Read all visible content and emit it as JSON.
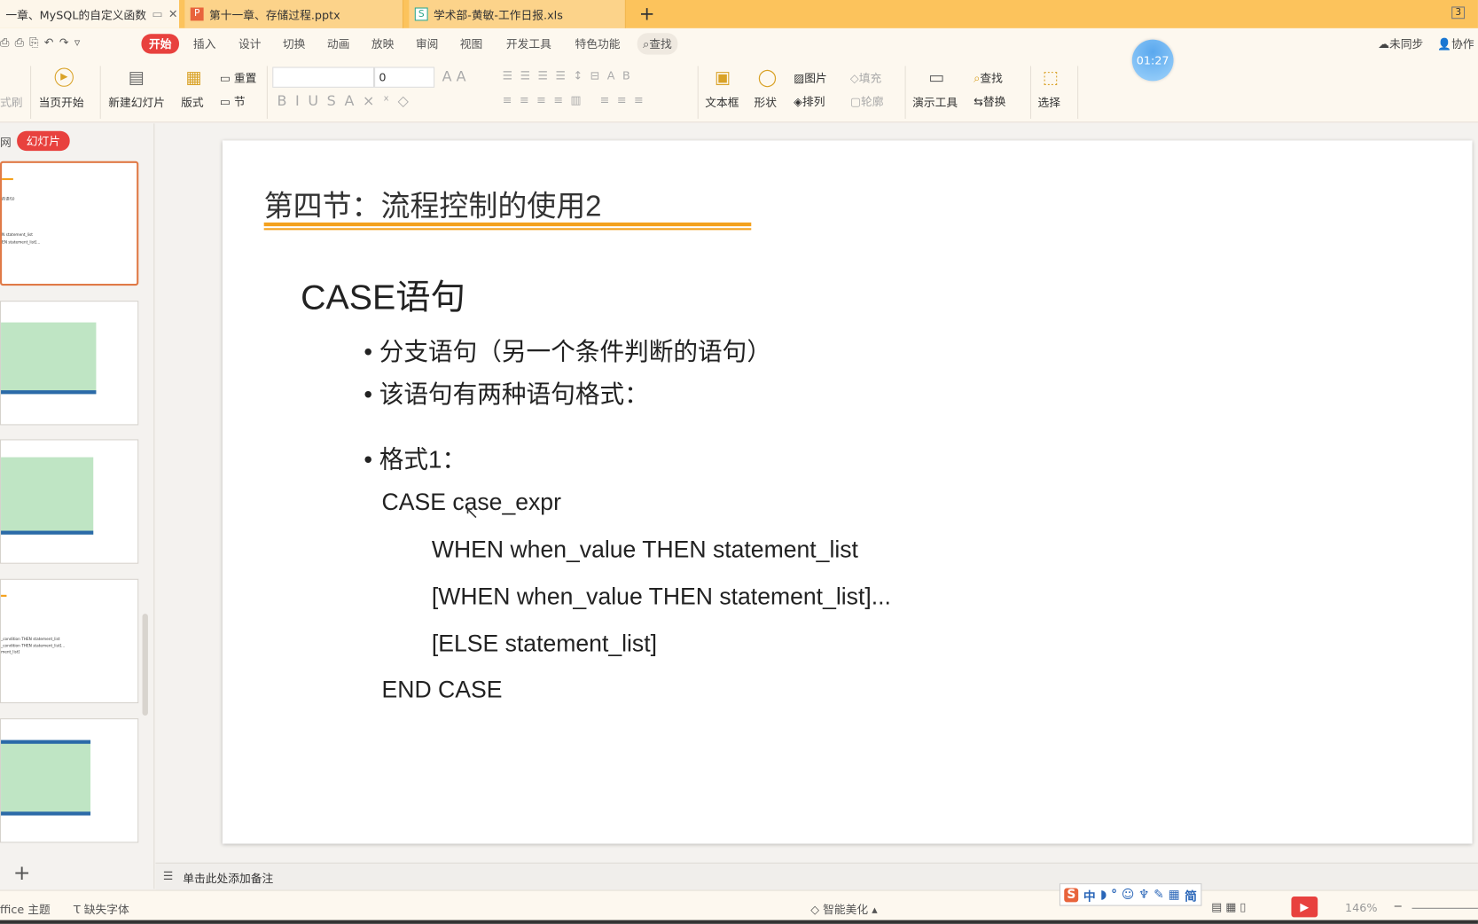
{
  "tabs": [
    {
      "label": "一章、MySQL的自定义函数",
      "icon": "document-icon"
    },
    {
      "label": "第十一章、存储过程.pptx",
      "icon": "ppt-file-icon",
      "icon_letter": "P",
      "color": "#e8643c"
    },
    {
      "label": "学术部-黄敏-工作日报.xls",
      "icon": "xls-file-icon",
      "icon_letter": "S",
      "color": "#2ba58a"
    }
  ],
  "new_tab": "+",
  "window_badge": "3",
  "menu": [
    "开始",
    "插入",
    "设计",
    "切换",
    "动画",
    "放映",
    "审阅",
    "视图",
    "开发工具",
    "特色功能"
  ],
  "search_label": "查找",
  "sync_label": "未同步",
  "collab_label": "协作",
  "timer": "01:27",
  "ribbon": {
    "format_brush": "式刷",
    "from_current": "当页开始",
    "new_slide": "新建幻灯片",
    "layout": "版式",
    "reset": "重置",
    "section": "节",
    "font_name": "",
    "font_size": "0",
    "textbox": "文本框",
    "shape": "形状",
    "picture": "图片",
    "fill": "填充",
    "arrange": "排列",
    "outline": "轮廓",
    "present_tools": "演示工具",
    "find": "查找",
    "replace": "替换",
    "select": "选择"
  },
  "panel": {
    "outline_tab": "网",
    "slides_tab": "幻灯片",
    "add": "+"
  },
  "thumbs": [
    {
      "lines": [
        "的语句)",
        "N statement_list",
        "EN statement_list]..."
      ]
    },
    {},
    {},
    {
      "lines": [
        "_condition THEN statement_list",
        "_condition THEN statement_list]...",
        "ment_list]"
      ]
    },
    {}
  ],
  "slide": {
    "title": "第四节：流程控制的使用2",
    "subtitle": "CASE语句",
    "bullets": [
      "分支语句（另一个条件判断的语句）",
      "该语句有两种语句格式：",
      "格式1："
    ],
    "code": [
      "CASE case_expr",
      "WHEN when_value THEN statement_list",
      "[WHEN when_value THEN statement_list]...",
      "[ELSE statement_list]",
      "END CASE"
    ],
    "accent": "#f4a11d"
  },
  "notes_placeholder": "单击此处添加备注",
  "status": {
    "theme": "ffice 主题",
    "missing_font": "缺失字体",
    "beautify": "智能美化",
    "zoom": "146%",
    "ime": [
      "中",
      "简"
    ]
  }
}
